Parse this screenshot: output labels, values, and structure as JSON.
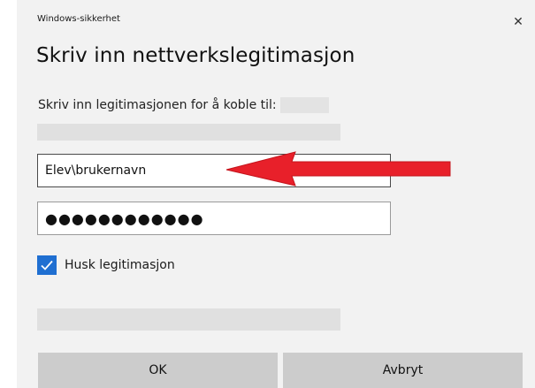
{
  "dialog": {
    "app_label": "Windows-sikkerhet",
    "close_glyph": "✕",
    "title": "Skriv inn nettverkslegitimasjon",
    "prompt": "Skriv inn legitimasjonen for å koble til:",
    "username_value": "Elev\\brukernavn",
    "password_mask": "●●●●●●●●●●●●",
    "remember_label": "Husk legitimasjon",
    "remember_checked": true,
    "ok_label": "OK",
    "cancel_label": "Avbryt"
  },
  "annotation": {
    "arrow_color": "#e8202a",
    "arrow_direction": "left"
  },
  "colors": {
    "dialog_bg": "#f2f2f2",
    "accent": "#1f6fd1",
    "button_bg": "#cccccc"
  }
}
